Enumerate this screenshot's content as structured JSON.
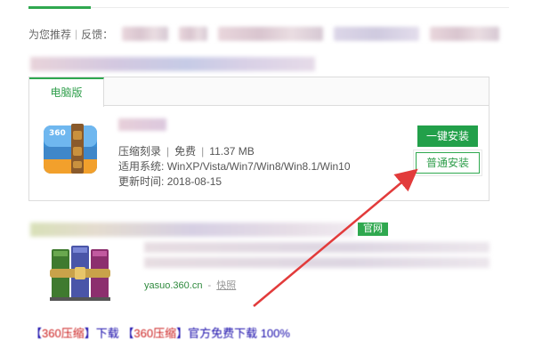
{
  "recommend": {
    "label": "为您推荐",
    "separator": "|",
    "feedback": "反馈："
  },
  "result1": {
    "tab_label": "电脑版",
    "category": "压缩刻录",
    "price": "免费",
    "size": "11.37 MB",
    "systems_label": "适用系统:",
    "systems_value": "WinXP/Vista/Win7/Win8/Win8.1/Win10",
    "update_label": "更新时间:",
    "update_value": "2018-08-15",
    "btn_one_click": "一键安装",
    "btn_normal": "普通安装",
    "icon_text": "360"
  },
  "result2": {
    "badge": "官网",
    "url": "yasuo.360.cn",
    "dash": "-",
    "snapshot": "快照"
  },
  "bottom": {
    "bracket_open_1": "【",
    "hl_1": "360压缩",
    "bracket_close_1": "】下载",
    "bracket_open_2": "【",
    "hl_2": "360压缩",
    "bracket_close_2": "】官方免费下载 100%"
  },
  "colors": {
    "accent_green": "#22a04a",
    "arrow_red": "#e23b3b",
    "link_blue": "#1a0dab"
  }
}
